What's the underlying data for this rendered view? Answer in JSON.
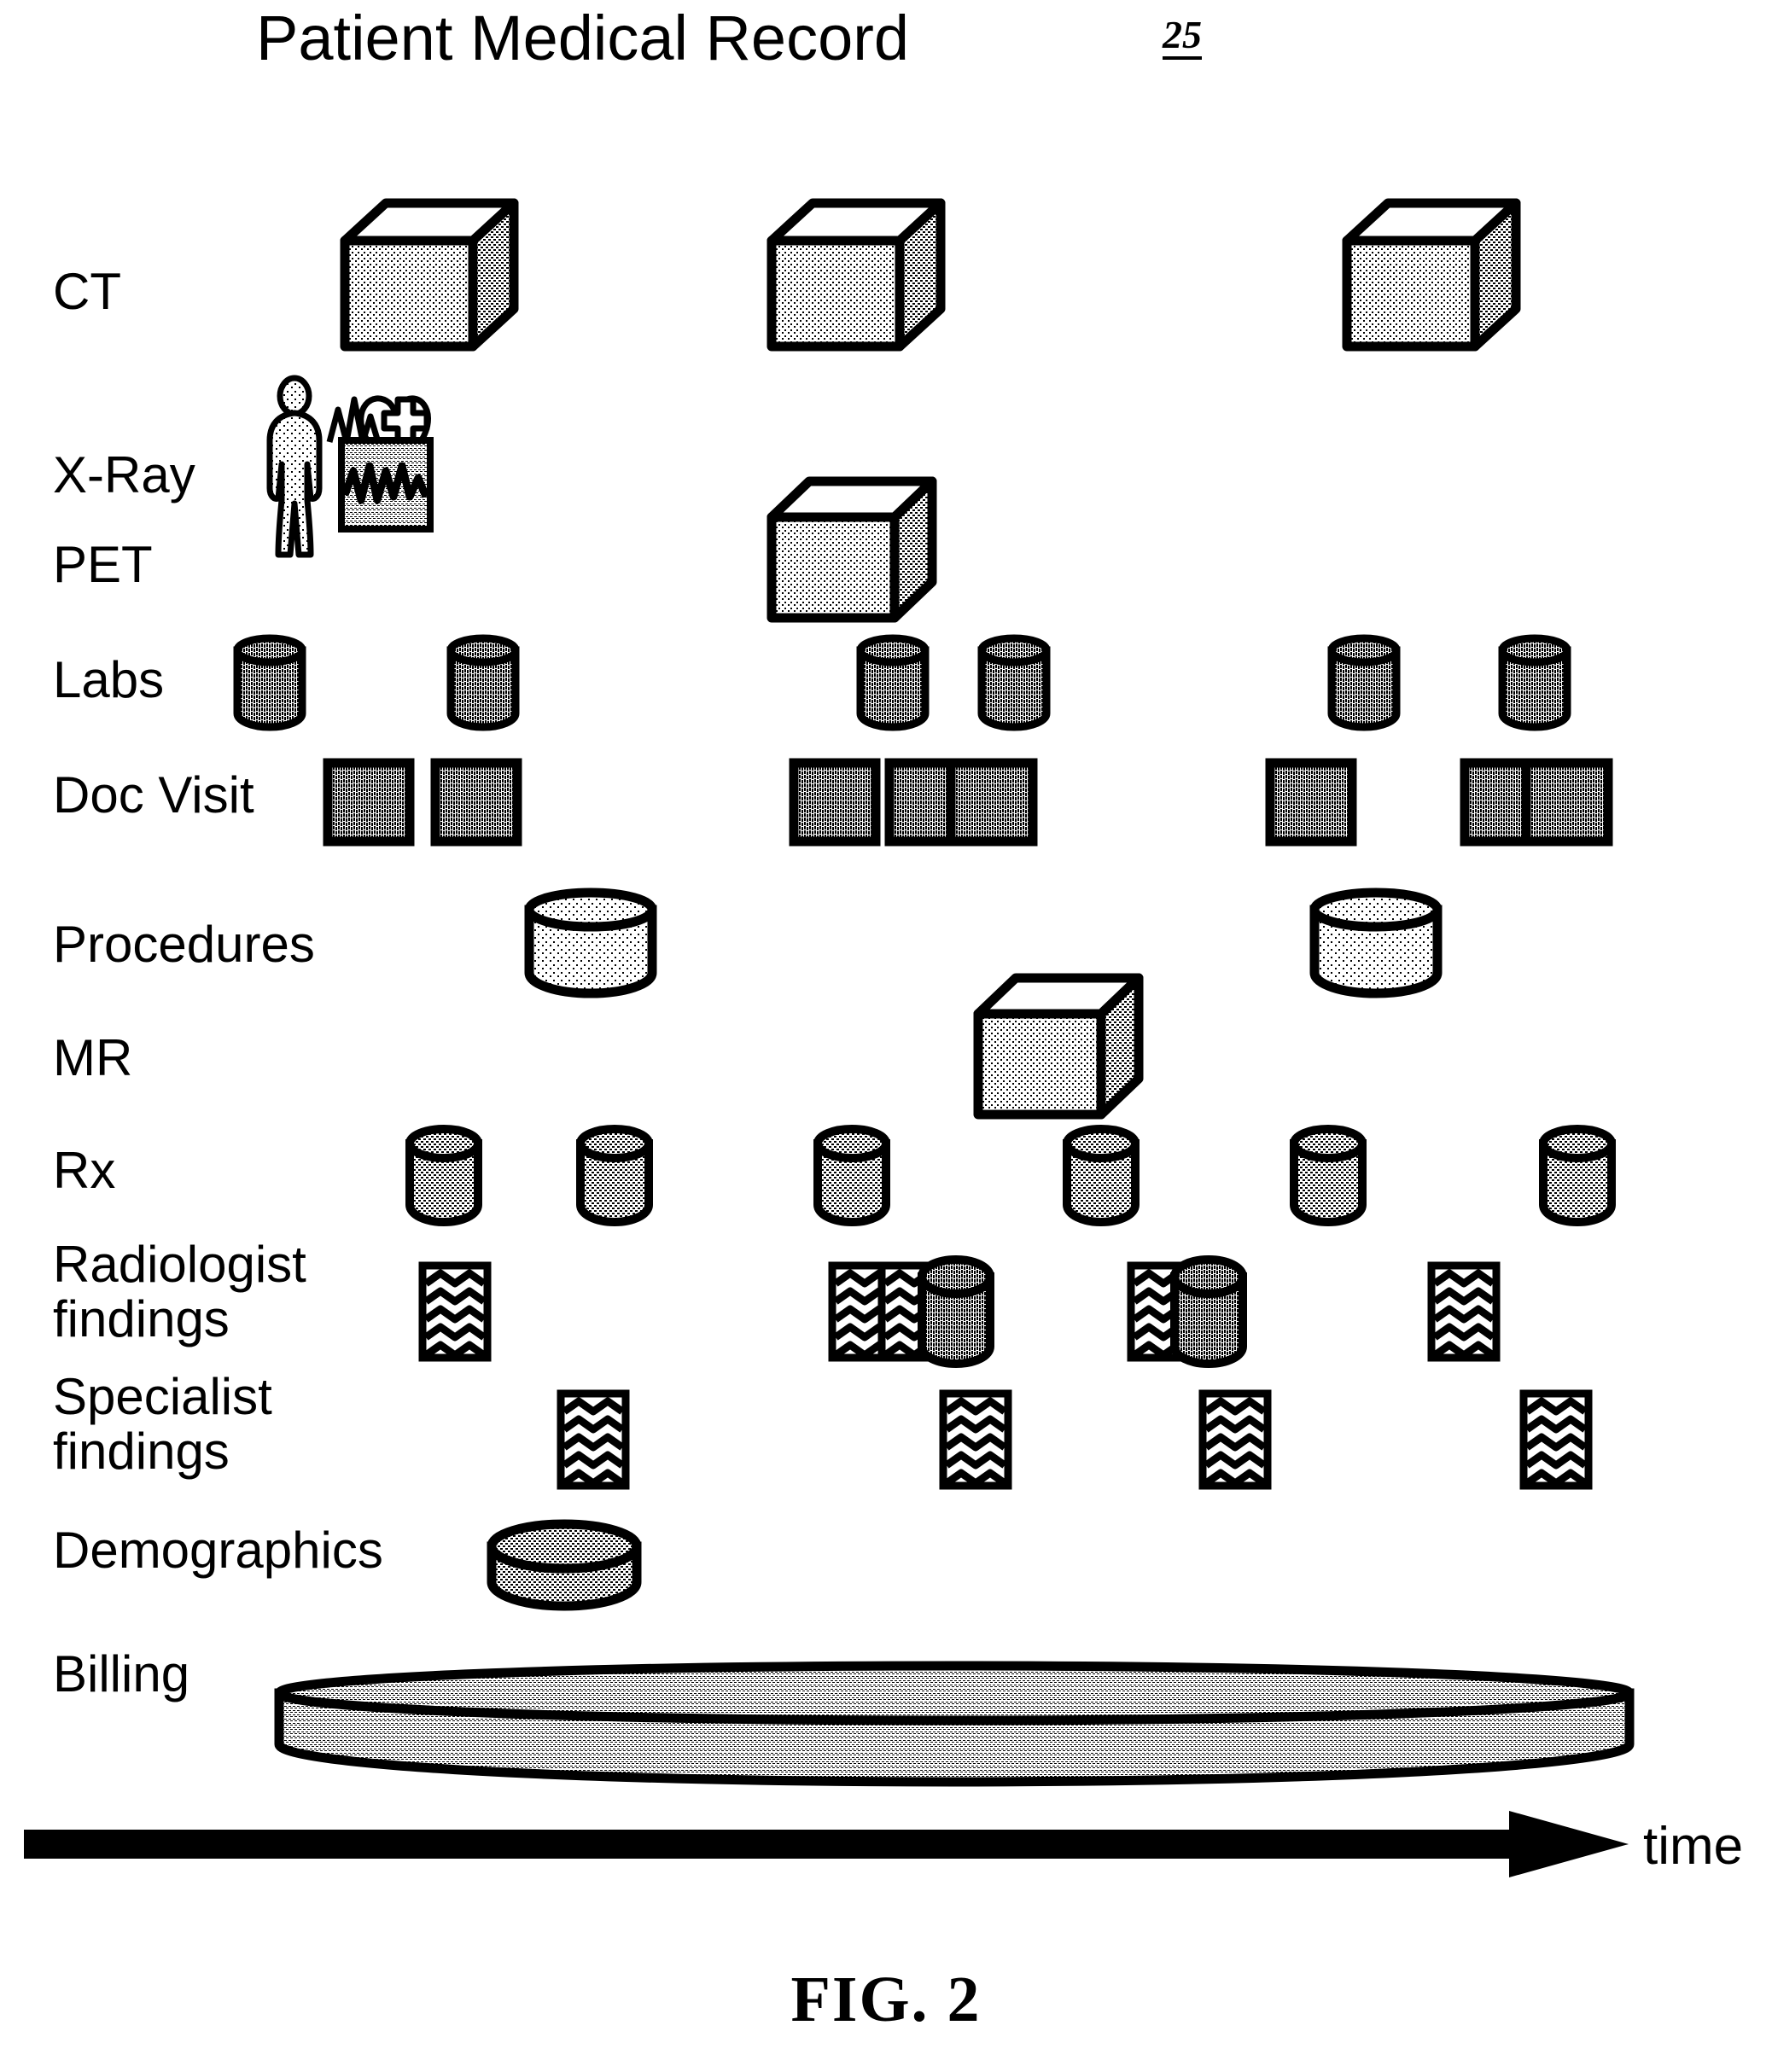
{
  "figure": {
    "title": "Patient Medical Record",
    "reference_number": "25",
    "caption": "FIG. 2",
    "axis_label": "time"
  },
  "rows": [
    {
      "id": "ct",
      "label": "CT"
    },
    {
      "id": "xray",
      "label": "X-Ray"
    },
    {
      "id": "pet",
      "label": "PET"
    },
    {
      "id": "labs",
      "label": "Labs"
    },
    {
      "id": "doc-visit",
      "label": "Doc Visit"
    },
    {
      "id": "procedures",
      "label": "Procedures"
    },
    {
      "id": "mr",
      "label": "MR"
    },
    {
      "id": "rx",
      "label": "Rx"
    },
    {
      "id": "radiologist",
      "label": "Radiologist\nfindings"
    },
    {
      "id": "specialist",
      "label": "Specialist\nfindings"
    },
    {
      "id": "demographics",
      "label": "Demographics"
    },
    {
      "id": "billing",
      "label": "Billing"
    }
  ],
  "icons": {
    "cube": "cube-icon",
    "cylinder_tall": "tall-cylinder-icon",
    "cylinder_wide": "wide-cylinder-icon",
    "square_block": "square-block-icon",
    "document": "wavy-document-icon",
    "disk": "wide-disk-icon",
    "patient_monitor": "patient-monitor-icon",
    "arrow": "time-arrow-icon"
  },
  "colors": {
    "ink": "#000000",
    "paper": "#ffffff",
    "fill_light": "#d9d9d9",
    "fill_mid": "#bdbdbd",
    "fill_dark": "#9a9a9a"
  }
}
